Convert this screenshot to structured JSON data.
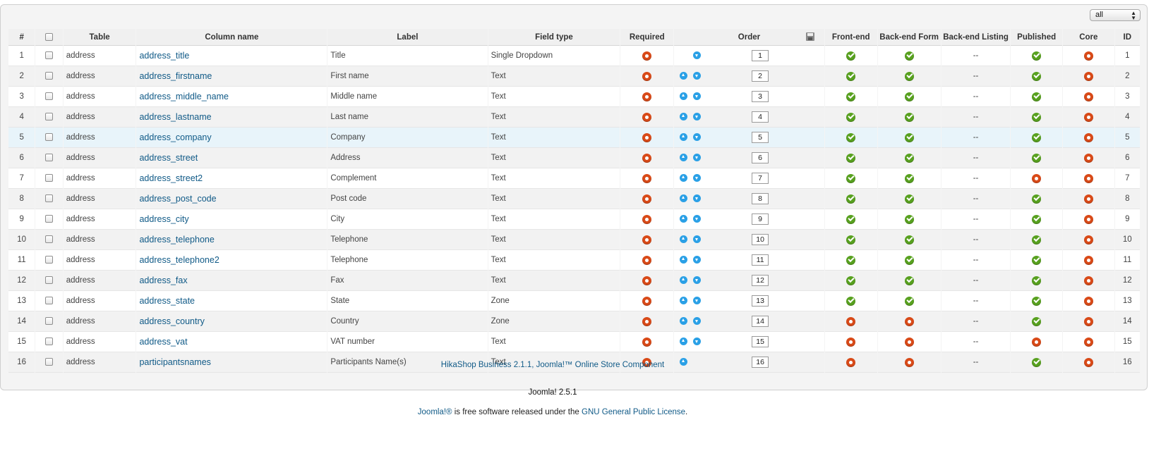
{
  "filter": {
    "value": "all"
  },
  "headers": {
    "num": "#",
    "table": "Table",
    "column_name": "Column name",
    "label": "Label",
    "field_type": "Field type",
    "required": "Required",
    "order": "Order",
    "front_end": "Front-end",
    "back_end_form": "Back-end Form",
    "back_end_listing": "Back-end Listing",
    "published": "Published",
    "core": "Core",
    "id": "ID"
  },
  "icons": {
    "yes": "green-check-icon",
    "no": "red-circle-icon",
    "up": "arrow-up-icon",
    "down": "arrow-down-icon",
    "save": "save-order-icon",
    "colors": {
      "red": "#d94a18",
      "green": "#58a11f",
      "blue": "#2aa0e6",
      "link": "#105a87"
    }
  },
  "rows": [
    {
      "num": "1",
      "table": "address",
      "column": "address_title",
      "label": "Title",
      "type": "Single Dropdown",
      "order": "1",
      "up": false,
      "down": true,
      "front": true,
      "form": true,
      "listing": "--",
      "published": true,
      "core": false,
      "id": "1"
    },
    {
      "num": "2",
      "table": "address",
      "column": "address_firstname",
      "label": "First name",
      "type": "Text",
      "order": "2",
      "up": true,
      "down": true,
      "front": true,
      "form": true,
      "listing": "--",
      "published": true,
      "core": false,
      "id": "2"
    },
    {
      "num": "3",
      "table": "address",
      "column": "address_middle_name",
      "label": "Middle name",
      "type": "Text",
      "order": "3",
      "up": true,
      "down": true,
      "front": true,
      "form": true,
      "listing": "--",
      "published": true,
      "core": false,
      "id": "3"
    },
    {
      "num": "4",
      "table": "address",
      "column": "address_lastname",
      "label": "Last name",
      "type": "Text",
      "order": "4",
      "up": true,
      "down": true,
      "front": true,
      "form": true,
      "listing": "--",
      "published": true,
      "core": false,
      "id": "4"
    },
    {
      "num": "5",
      "table": "address",
      "column": "address_company",
      "label": "Company",
      "type": "Text",
      "order": "5",
      "up": true,
      "down": true,
      "front": true,
      "form": true,
      "listing": "--",
      "published": true,
      "core": false,
      "id": "5"
    },
    {
      "num": "6",
      "table": "address",
      "column": "address_street",
      "label": "Address",
      "type": "Text",
      "order": "6",
      "up": true,
      "down": true,
      "front": true,
      "form": true,
      "listing": "--",
      "published": true,
      "core": false,
      "id": "6"
    },
    {
      "num": "7",
      "table": "address",
      "column": "address_street2",
      "label": "Complement",
      "type": "Text",
      "order": "7",
      "up": true,
      "down": true,
      "front": true,
      "form": true,
      "listing": "--",
      "published": false,
      "core": false,
      "id": "7"
    },
    {
      "num": "8",
      "table": "address",
      "column": "address_post_code",
      "label": "Post code",
      "type": "Text",
      "order": "8",
      "up": true,
      "down": true,
      "front": true,
      "form": true,
      "listing": "--",
      "published": true,
      "core": false,
      "id": "8"
    },
    {
      "num": "9",
      "table": "address",
      "column": "address_city",
      "label": "City",
      "type": "Text",
      "order": "9",
      "up": true,
      "down": true,
      "front": true,
      "form": true,
      "listing": "--",
      "published": true,
      "core": false,
      "id": "9"
    },
    {
      "num": "10",
      "table": "address",
      "column": "address_telephone",
      "label": "Telephone",
      "type": "Text",
      "order": "10",
      "up": true,
      "down": true,
      "front": true,
      "form": true,
      "listing": "--",
      "published": true,
      "core": false,
      "id": "10"
    },
    {
      "num": "11",
      "table": "address",
      "column": "address_telephone2",
      "label": "Telephone",
      "type": "Text",
      "order": "11",
      "up": true,
      "down": true,
      "front": true,
      "form": true,
      "listing": "--",
      "published": true,
      "core": false,
      "id": "11"
    },
    {
      "num": "12",
      "table": "address",
      "column": "address_fax",
      "label": "Fax",
      "type": "Text",
      "order": "12",
      "up": true,
      "down": true,
      "front": true,
      "form": true,
      "listing": "--",
      "published": true,
      "core": false,
      "id": "12"
    },
    {
      "num": "13",
      "table": "address",
      "column": "address_state",
      "label": "State",
      "type": "Zone",
      "order": "13",
      "up": true,
      "down": true,
      "front": true,
      "form": true,
      "listing": "--",
      "published": true,
      "core": false,
      "id": "13"
    },
    {
      "num": "14",
      "table": "address",
      "column": "address_country",
      "label": "Country",
      "type": "Zone",
      "order": "14",
      "up": true,
      "down": true,
      "front": false,
      "form": false,
      "listing": "--",
      "published": true,
      "core": false,
      "id": "14"
    },
    {
      "num": "15",
      "table": "address",
      "column": "address_vat",
      "label": "VAT number",
      "type": "Text",
      "order": "15",
      "up": true,
      "down": true,
      "front": false,
      "form": false,
      "listing": "--",
      "published": false,
      "core": false,
      "id": "15"
    },
    {
      "num": "16",
      "table": "address",
      "column": "participantsnames",
      "label": "Participants Name(s)",
      "type": "Text",
      "order": "16",
      "up": true,
      "down": false,
      "front": false,
      "form": false,
      "listing": "--",
      "published": true,
      "core": false,
      "id": "16"
    }
  ],
  "credit": "HikaShop Business 2.1.1, Joomla!™ Online Store Component",
  "footer": {
    "version": "Joomla! 2.5.1",
    "license_link1": "Joomla!®",
    "license_mid": " is free software released under the ",
    "license_link2": "GNU General Public License",
    "license_end": "."
  }
}
